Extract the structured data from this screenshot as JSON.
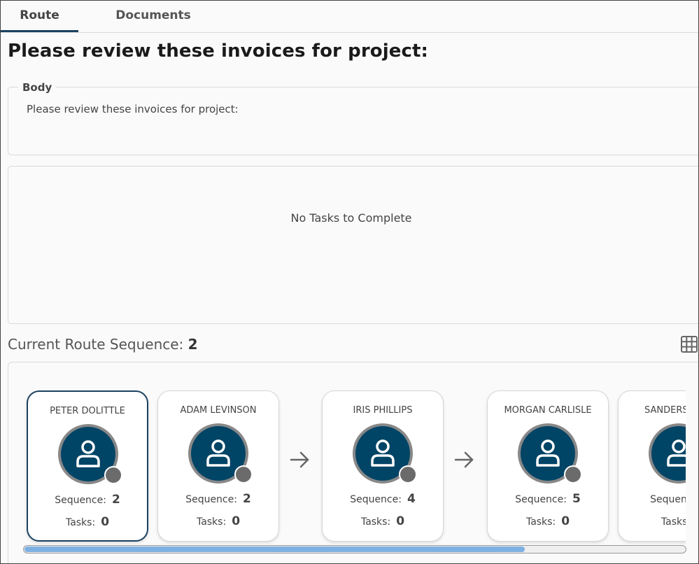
{
  "tabs": {
    "route": "Route",
    "documents": "Documents"
  },
  "page_title": "Please review these invoices for project:",
  "body_section": {
    "legend": "Body",
    "text": "Please review these invoices for project:"
  },
  "tasks": {
    "empty_text": "No Tasks to Complete"
  },
  "route_sequence": {
    "label": "Current Route Sequence:",
    "current": "2",
    "grid_icon": "grid-icon",
    "sequence_label": "Sequence:",
    "tasks_label": "Tasks:",
    "cards": [
      {
        "name": "PETER DOLITTLE",
        "sequence": "2",
        "tasks": "0",
        "selected": true
      },
      {
        "name": "ADAM LEVINSON",
        "sequence": "2",
        "tasks": "0"
      },
      {
        "name": "IRIS PHILLIPS",
        "sequence": "4",
        "tasks": "0"
      },
      {
        "name": "MORGAN CARLISLE",
        "sequence": "5",
        "tasks": "0"
      },
      {
        "name": "SANDERSON M",
        "sequence": "",
        "tasks": ""
      }
    ],
    "scroll_position": 0.76
  },
  "colors": {
    "accent": "#1b4160",
    "avatar": "#004466",
    "scroll_thumb": "#7eb1e2"
  }
}
